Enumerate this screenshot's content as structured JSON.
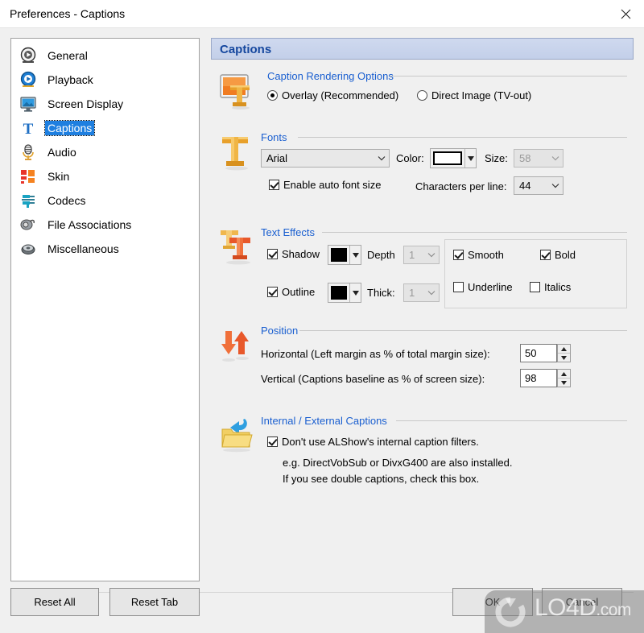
{
  "window": {
    "title": "Preferences - Captions",
    "close_icon": "close-icon"
  },
  "sidebar": {
    "items": [
      {
        "label": "General",
        "icon": "general-icon",
        "selected": false
      },
      {
        "label": "Playback",
        "icon": "playback-icon",
        "selected": false
      },
      {
        "label": "Screen Display",
        "icon": "screen-display-icon",
        "selected": false
      },
      {
        "label": "Captions",
        "icon": "captions-icon",
        "selected": true
      },
      {
        "label": "Audio",
        "icon": "audio-icon",
        "selected": false
      },
      {
        "label": "Skin",
        "icon": "skin-icon",
        "selected": false
      },
      {
        "label": "Codecs",
        "icon": "codecs-icon",
        "selected": false
      },
      {
        "label": "File Associations",
        "icon": "file-associations-icon",
        "selected": false
      },
      {
        "label": "Miscellaneous",
        "icon": "miscellaneous-icon",
        "selected": false
      }
    ]
  },
  "panel": {
    "header": "Captions",
    "rendering": {
      "title": "Caption Rendering Options",
      "icon": "caption-render-icon",
      "option_overlay": "Overlay (Recommended)",
      "option_direct": "Direct Image (TV-out)",
      "selected": "overlay"
    },
    "fonts": {
      "title": "Fonts",
      "icon": "font-icon",
      "font_value": "Arial",
      "color_label": "Color:",
      "color_value": "#ffffff",
      "size_label": "Size:",
      "size_value": "58",
      "size_disabled": true,
      "auto_font_size_label": "Enable auto font size",
      "auto_font_size_checked": true,
      "chars_per_line_label": "Characters per line:",
      "chars_per_line_value": "44"
    },
    "text_effects": {
      "title": "Text Effects",
      "icon": "text-effects-icon",
      "shadow_label": "Shadow",
      "shadow_checked": true,
      "shadow_color": "#000000",
      "depth_label": "Depth",
      "depth_value": "1",
      "depth_disabled": true,
      "outline_label": "Outline",
      "outline_checked": true,
      "outline_color": "#000000",
      "thick_label": "Thick:",
      "thick_value": "1",
      "thick_disabled": true,
      "smooth_label": "Smooth",
      "smooth_checked": true,
      "bold_label": "Bold",
      "bold_checked": true,
      "underline_label": "Underline",
      "underline_checked": false,
      "italics_label": "Italics",
      "italics_checked": false
    },
    "position": {
      "title": "Position",
      "icon": "position-icon",
      "horizontal_label": "Horizontal (Left margin as % of total margin size):",
      "horizontal_value": "50",
      "vertical_label": "Vertical (Captions baseline as % of screen size):",
      "vertical_value": "98"
    },
    "captions_src": {
      "title": "Internal / External Captions",
      "icon": "folder-in-icon",
      "checkbox_label": "Don't use ALShow's internal caption filters.",
      "checkbox_checked": true,
      "note_line1": "e.g. DirectVobSub or DivxG400 are also installed.",
      "note_line2": "If you see double captions, check this box."
    }
  },
  "footer": {
    "reset_all": "Reset All",
    "reset_tab": "Reset Tab",
    "ok": "OK",
    "cancel": "Cancel"
  },
  "watermark": {
    "text": "LO4D",
    "suffix": ".com"
  }
}
